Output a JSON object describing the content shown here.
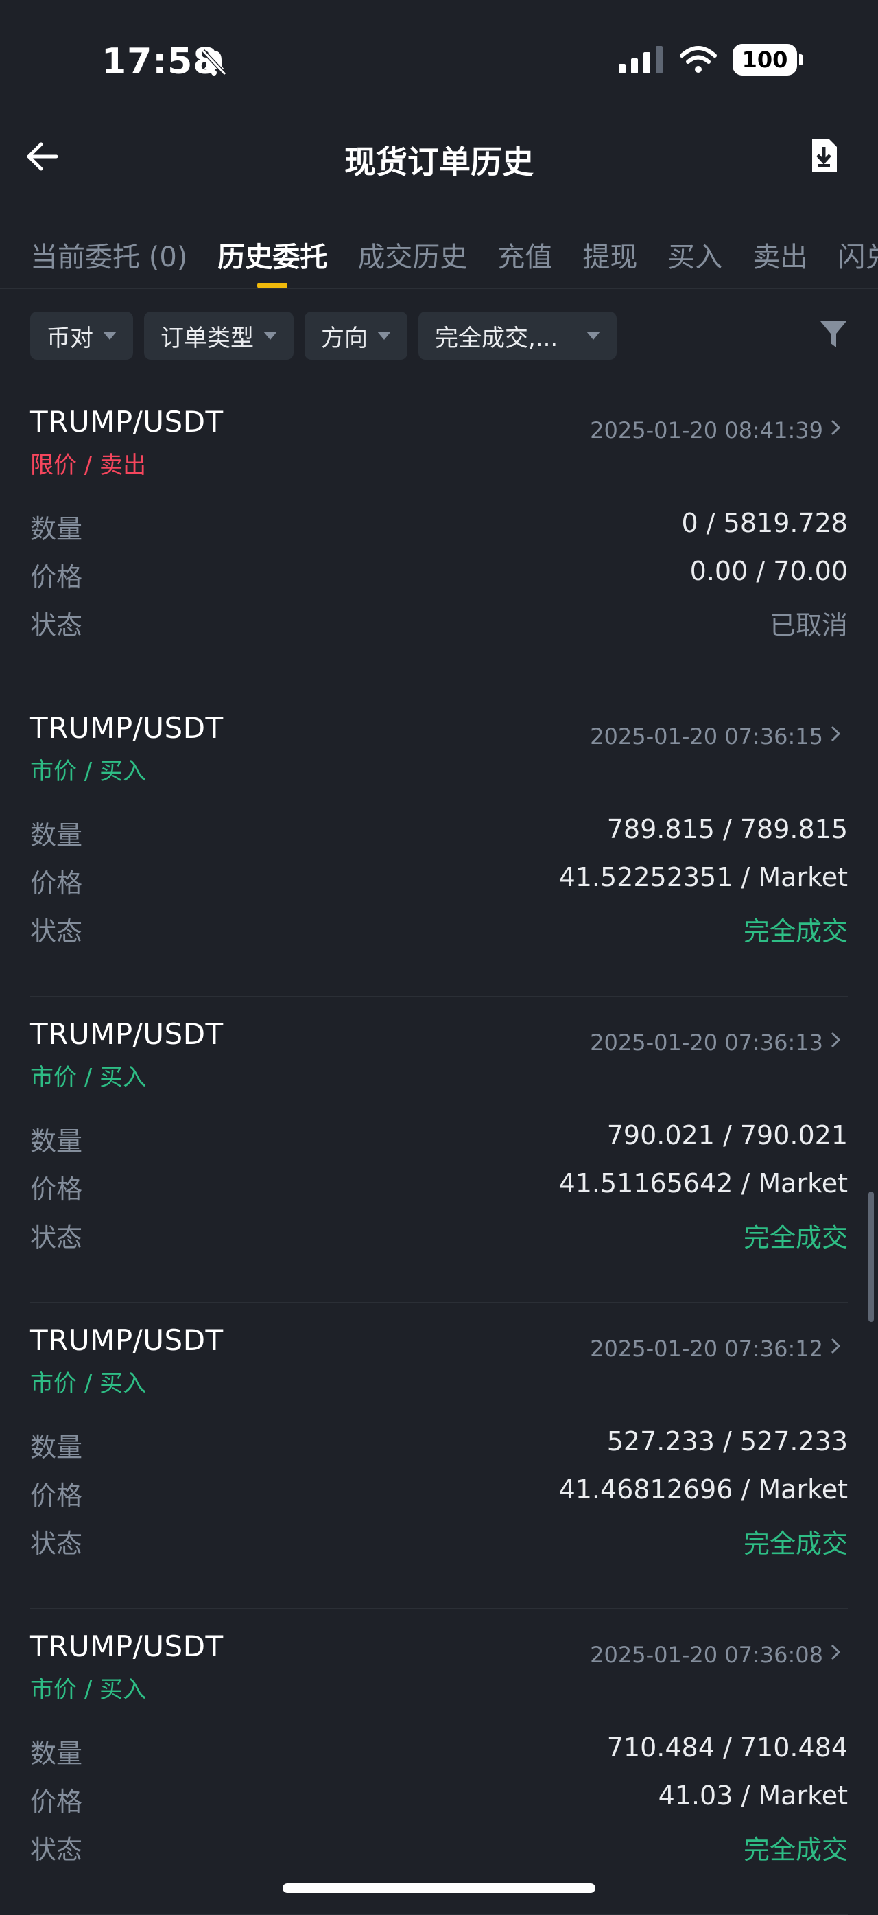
{
  "status_bar": {
    "time": "17:58",
    "battery": "100"
  },
  "header": {
    "title": "现货订单历史"
  },
  "tabs": [
    {
      "label": "当前委托 (0)",
      "active": false
    },
    {
      "label": "历史委托",
      "active": true
    },
    {
      "label": "成交历史",
      "active": false
    },
    {
      "label": "充值",
      "active": false
    },
    {
      "label": "提现",
      "active": false
    },
    {
      "label": "买入",
      "active": false
    },
    {
      "label": "卖出",
      "active": false
    },
    {
      "label": "闪兑",
      "active": false
    }
  ],
  "filters": [
    {
      "label": "币对"
    },
    {
      "label": "订单类型"
    },
    {
      "label": "方向"
    },
    {
      "label": "完全成交,..."
    }
  ],
  "field_labels": {
    "quantity": "数量",
    "price": "价格",
    "status": "状态"
  },
  "orders": [
    {
      "pair": "TRUMP/USDT",
      "type": "限价 / 卖出",
      "side": "sell",
      "datetime": "2025-01-20 08:41:39",
      "quantity": "0 / 5819.728",
      "price": "0.00 / 70.00",
      "status": "已取消",
      "status_kind": "cancel"
    },
    {
      "pair": "TRUMP/USDT",
      "type": "市价 / 买入",
      "side": "buy",
      "datetime": "2025-01-20 07:36:15",
      "quantity": "789.815 / 789.815",
      "price": "41.52252351 / Market",
      "status": "完全成交",
      "status_kind": "filled"
    },
    {
      "pair": "TRUMP/USDT",
      "type": "市价 / 买入",
      "side": "buy",
      "datetime": "2025-01-20 07:36:13",
      "quantity": "790.021 / 790.021",
      "price": "41.51165642 / Market",
      "status": "完全成交",
      "status_kind": "filled"
    },
    {
      "pair": "TRUMP/USDT",
      "type": "市价 / 买入",
      "side": "buy",
      "datetime": "2025-01-20 07:36:12",
      "quantity": "527.233 / 527.233",
      "price": "41.46812696 / Market",
      "status": "完全成交",
      "status_kind": "filled"
    },
    {
      "pair": "TRUMP/USDT",
      "type": "市价 / 买入",
      "side": "buy",
      "datetime": "2025-01-20 07:36:08",
      "quantity": "710.484 / 710.484",
      "price": "41.03 / Market",
      "status": "完全成交",
      "status_kind": "filled"
    }
  ],
  "colors": {
    "background": "#1e2128",
    "accent": "#f0b90b",
    "sell": "#f6465d",
    "buy": "#2ebd85",
    "muted": "#848e9c"
  }
}
